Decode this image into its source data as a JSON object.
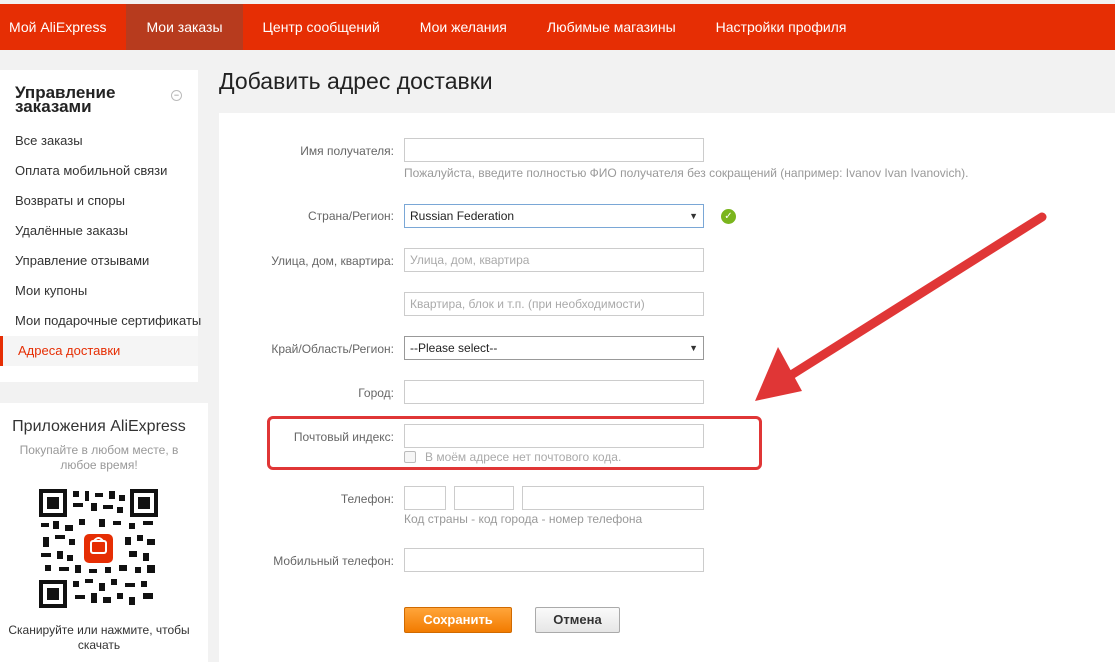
{
  "nav": {
    "brand_prefix": "Мой ",
    "brand_name": "AliExpress",
    "items": [
      {
        "label": "Мои заказы",
        "active": true
      },
      {
        "label": "Центр сообщений"
      },
      {
        "label": "Мои желания"
      },
      {
        "label": "Любимые магазины"
      },
      {
        "label": "Настройки профиля"
      }
    ]
  },
  "sidebar": {
    "title_line1": "Управление",
    "title_line2": "заказами",
    "collapse_symbol": "−",
    "items": [
      {
        "label": "Все заказы"
      },
      {
        "label": "Оплата мобильной связи"
      },
      {
        "label": "Возвраты и споры"
      },
      {
        "label": "Удалённые заказы"
      },
      {
        "label": "Управление отзывами"
      },
      {
        "label": "Мои купоны"
      },
      {
        "label": "Мои подарочные сертификаты"
      },
      {
        "label": "Адреса доставки",
        "active": true
      }
    ]
  },
  "apps": {
    "title": "Приложения AliExpress",
    "subtitle": "Покупайте в любом месте, в любое время!",
    "footer": "Сканируйте или нажмите, чтобы скачать"
  },
  "page": {
    "title": "Добавить адрес доставки"
  },
  "form": {
    "recipient": {
      "label": "Имя получателя:",
      "value": "",
      "hint": "Пожалуйста, введите полностью ФИО получателя без сокращений (например: Ivanov Ivan Ivanovich)."
    },
    "country": {
      "label": "Страна/Регион:",
      "value": "Russian Federation"
    },
    "street": {
      "label": "Улица, дом, квартира:",
      "placeholder": "Улица, дом, квартира"
    },
    "apartment": {
      "placeholder": "Квартира, блок и т.п. (при необходимости)"
    },
    "region": {
      "label": "Край/Область/Регион:",
      "value": "--Please select--"
    },
    "city": {
      "label": "Город:",
      "value": ""
    },
    "postal": {
      "label": "Почтовый индекс:",
      "value": "",
      "no_code_label": "В моём адресе нет почтового кода."
    },
    "phone": {
      "label": "Телефон:",
      "hint": "Код страны - код города - номер телефона"
    },
    "mobile": {
      "label": "Мобильный телефон:",
      "value": ""
    },
    "save_label": "Сохранить",
    "cancel_label": "Отмена"
  },
  "colors": {
    "nav_bg": "#e62e04",
    "nav_active": "#b73b1e",
    "accent": "#e62e04",
    "save_button": "#f27b00",
    "highlight": "#e03636",
    "ok_icon": "#7ab51d"
  }
}
